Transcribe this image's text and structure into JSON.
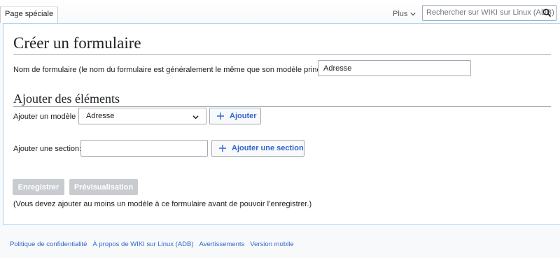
{
  "header": {
    "tab_special": "Page spéciale",
    "more_label": "Plus",
    "search_placeholder": "Rechercher sur WIKI sur Linux (ADB)"
  },
  "page": {
    "title": "Créer un formulaire",
    "form_name_label": "Nom de formulaire (le nom du formulaire est généralement le même que son modèle principal) :",
    "form_name_value": "Adresse",
    "section_heading": "Ajouter des éléments",
    "add_template_label": "Ajouter un modèle :",
    "template_selected": "Adresse",
    "add_button": "Ajouter",
    "add_section_label": "Ajouter une section:",
    "section_input_value": "",
    "add_section_button": "Ajouter une section",
    "save_button": "Enregistrer",
    "preview_button": "Prévisualisation",
    "note": "(Vous devez ajouter au moins un modèle à ce formulaire avant de pouvoir l’enregistrer.)"
  },
  "footer": {
    "links": [
      "Politique de confidentialité",
      "À propos de WIKI sur Linux (ADB)",
      "Avertissements",
      "Version mobile"
    ]
  },
  "colors": {
    "link": "#3366cc",
    "disabled_button": "#c8ccd1",
    "content_border": "#a7d7f9"
  }
}
